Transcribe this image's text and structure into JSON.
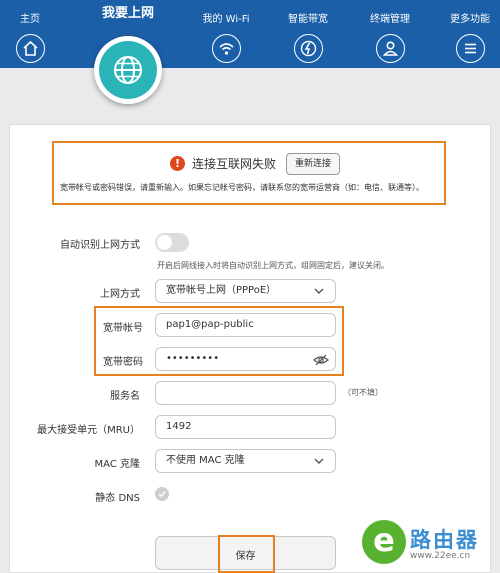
{
  "nav": {
    "items": [
      {
        "label": "主页",
        "icon": "home-icon"
      },
      {
        "label": "我要上网",
        "icon": "globe-icon",
        "active": true
      },
      {
        "label": "我的 Wi-Fi",
        "icon": "wifi-icon"
      },
      {
        "label": "智能带宽",
        "icon": "bandwidth-icon"
      },
      {
        "label": "终端管理",
        "icon": "user-icon"
      },
      {
        "label": "更多功能",
        "icon": "menu-icon"
      }
    ]
  },
  "alert": {
    "icon": "!",
    "title": "连接互联网失败",
    "reconnect_label": "重新连接",
    "description": "宽带帐号或密码错误，请重新输入。如果忘记帐号密码，请联系您的宽带运营商（如：电信、联通等）。"
  },
  "form": {
    "auto_detect_label": "自动识别上网方式",
    "auto_detect_enabled": false,
    "auto_detect_hint": "开启后网线接入时将自动识别上网方式，组网固定后，建议关闭。",
    "mode_label": "上网方式",
    "mode_value": "宽带帐号上网（PPPoE）",
    "account_label": "宽带帐号",
    "account_value": "pap1@pap-public",
    "password_label": "宽带密码",
    "password_value": "•••••••••",
    "service_label": "服务名",
    "service_value": "",
    "service_optional": "（可不填）",
    "mru_label": "最大接受单元（MRU）",
    "mru_value": "1492",
    "mac_label": "MAC 克隆",
    "mac_value": "不使用 MAC 克隆",
    "dns_label": "静态 DNS",
    "dns_checked": false,
    "save_label": "保存"
  },
  "watermark": {
    "letter": "e",
    "name": "路由器",
    "url": "www.22ee.cn"
  },
  "colors": {
    "header": "#1a5fa8",
    "active": "#2bb4b8",
    "highlight": "#e3821f",
    "error": "#e0461c"
  }
}
